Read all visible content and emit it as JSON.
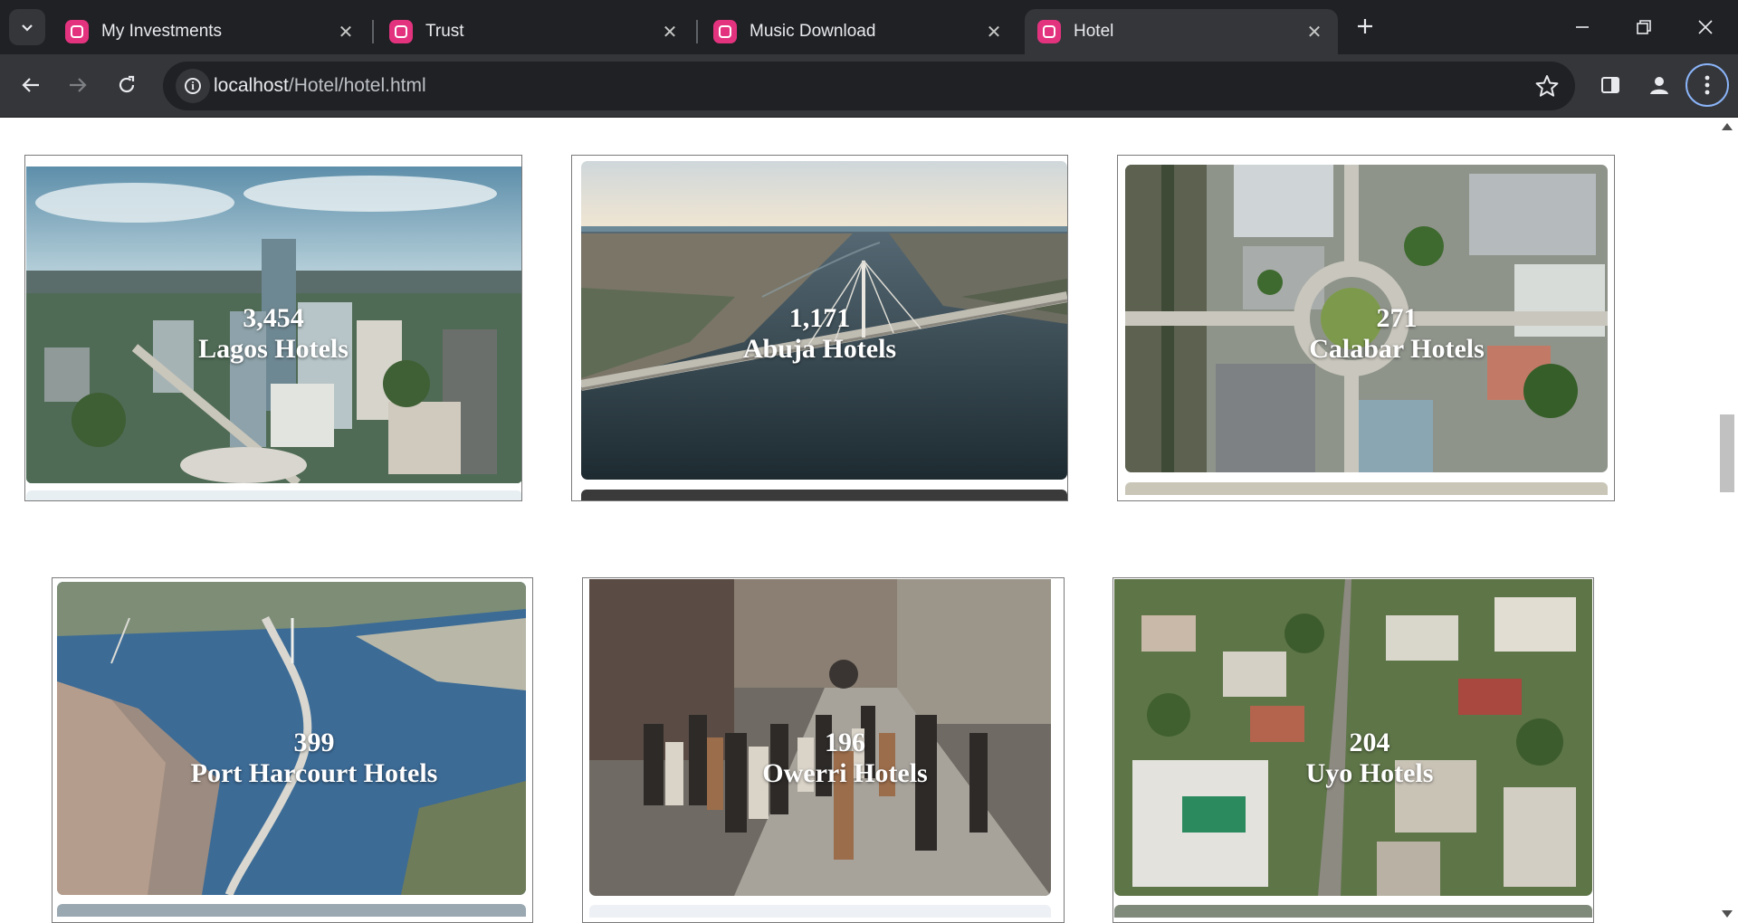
{
  "browser": {
    "tabs": [
      {
        "title": "My Investments",
        "active": false
      },
      {
        "title": "Trust",
        "active": false
      },
      {
        "title": "Music Download",
        "active": false
      },
      {
        "title": "Hotel",
        "active": true
      }
    ],
    "url_host": "localhost",
    "url_path": "/Hotel/hotel.html",
    "icons": {
      "tab_search": "chevron-down-icon",
      "new_tab": "plus-icon",
      "back": "arrow-left-icon",
      "forward": "arrow-right-icon",
      "reload": "reload-icon",
      "site_info": "info-icon",
      "bookmark": "star-icon",
      "side_panel": "side-panel-icon",
      "profile": "person-icon",
      "menu": "kebab-menu-icon"
    }
  },
  "cities": [
    {
      "count": "3,454",
      "label": "Lagos Hotels",
      "photo": "Lagos skyline aerial"
    },
    {
      "count": "1,171",
      "label": "Abuja Hotels",
      "photo": "bridge over lagoon aerial"
    },
    {
      "count": "271",
      "label": "Calabar Hotels",
      "photo": "roundabout aerial top-down"
    },
    {
      "count": "399",
      "label": "Port Harcourt Hotels",
      "photo": "bridge across bay aerial"
    },
    {
      "count": "196",
      "label": "Owerri Hotels",
      "photo": "busy market street"
    },
    {
      "count": "204",
      "label": "Uyo Hotels",
      "photo": "town street aerial"
    }
  ],
  "colors": {
    "chrome_dark": "#202124",
    "chrome_toolbar": "#35363a",
    "favicon": "#e3337f",
    "focus_ring": "#8ab4f8"
  }
}
